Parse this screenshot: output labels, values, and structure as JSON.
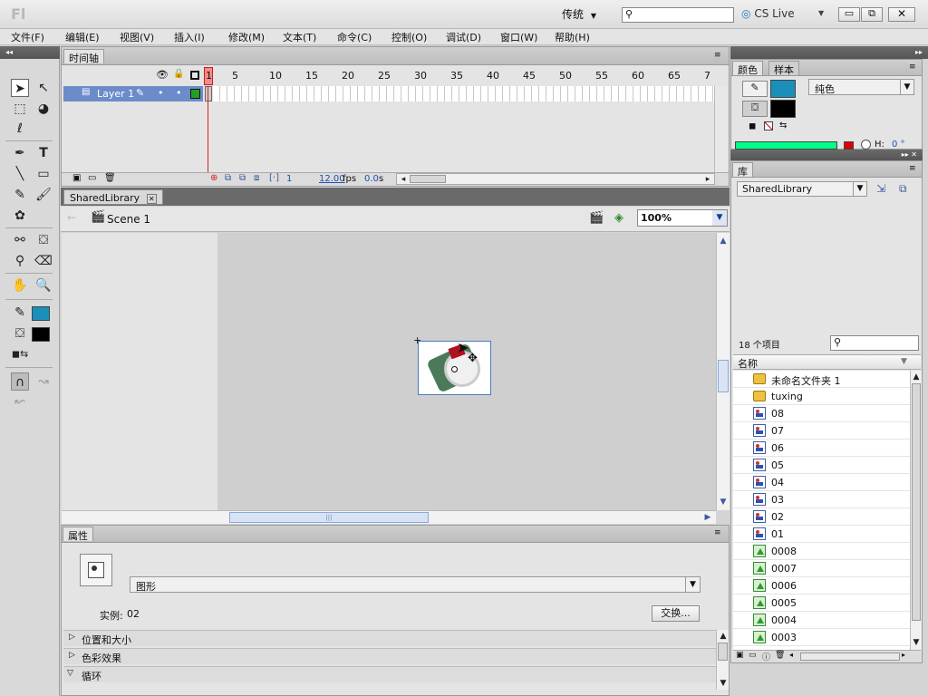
{
  "titlebar": {
    "app_logo": "Fl",
    "workspace": "传统",
    "search_placeholder": "",
    "cs_live": "CS Live"
  },
  "menu": [
    "文件(F)",
    "编辑(E)",
    "视图(V)",
    "插入(I)",
    "修改(M)",
    "文本(T)",
    "命令(C)",
    "控制(O)",
    "调试(D)",
    "窗口(W)",
    "帮助(H)"
  ],
  "timeline": {
    "panel_title": "时间轴",
    "layer_name": "Layer 1",
    "frame_numbers": [
      "1",
      "5",
      "10",
      "15",
      "20",
      "25",
      "30",
      "35",
      "40",
      "45",
      "50",
      "55",
      "60",
      "65",
      "7"
    ],
    "current_frame": "1",
    "fps": "12.00",
    "fps_unit": "fps",
    "elapsed": "0.0",
    "elapsed_unit": "s"
  },
  "document": {
    "tab_name": "SharedLibrary",
    "scene": "Scene 1",
    "zoom": "100%"
  },
  "properties": {
    "panel_title": "属性",
    "type_select": "图形",
    "instance_label": "实例:",
    "instance_value": "02",
    "swap_button": "交换...",
    "sections": [
      "位置和大小",
      "色彩效果",
      "循环"
    ]
  },
  "color_panel": {
    "tabs": [
      "颜色",
      "样本"
    ],
    "fill_type": "纯色",
    "stroke_color": "#1a8fba",
    "fill_color": "#000000",
    "spectrum_color": "#00ff88",
    "h_label": "H:",
    "h_value": "0 °"
  },
  "library": {
    "panel_title": "库",
    "library_select": "SharedLibrary",
    "item_count": "18 个项目",
    "column_name": "名称",
    "items": [
      {
        "name": "未命名文件夹 1",
        "kind": "folder"
      },
      {
        "name": "tuxing",
        "kind": "folder"
      },
      {
        "name": "08",
        "kind": "bitmap"
      },
      {
        "name": "07",
        "kind": "bitmap"
      },
      {
        "name": "06",
        "kind": "bitmap"
      },
      {
        "name": "05",
        "kind": "bitmap"
      },
      {
        "name": "04",
        "kind": "bitmap"
      },
      {
        "name": "03",
        "kind": "bitmap"
      },
      {
        "name": "02",
        "kind": "bitmap"
      },
      {
        "name": "01",
        "kind": "bitmap"
      },
      {
        "name": "0008",
        "kind": "graphic"
      },
      {
        "name": "0007",
        "kind": "graphic"
      },
      {
        "name": "0006",
        "kind": "graphic"
      },
      {
        "name": "0005",
        "kind": "graphic"
      },
      {
        "name": "0004",
        "kind": "graphic"
      },
      {
        "name": "0003",
        "kind": "graphic"
      }
    ]
  },
  "tools": {
    "stroke_color": "#1a8fba",
    "fill_color": "#000000"
  }
}
